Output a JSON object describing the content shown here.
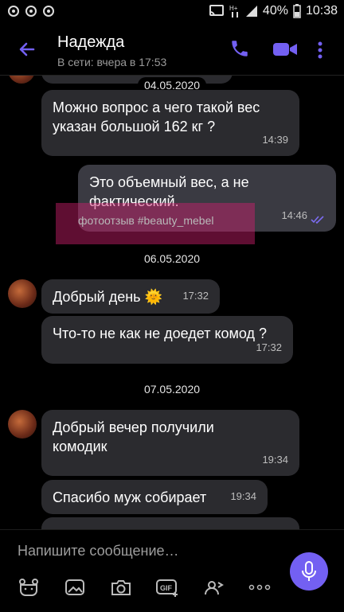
{
  "status_bar": {
    "battery": "40%",
    "time": "10:38"
  },
  "header": {
    "contact_name": "Надежда",
    "last_seen": "В сети: вчера в 17:53"
  },
  "messages": [
    {
      "date": "04.05.2020"
    },
    {
      "text": "Можно вопрос а чего такой вес указан большой 162 кг ?",
      "time": "14:39"
    },
    {
      "text": "Это объемный вес,  а не фактический.",
      "time": "14:46"
    },
    {
      "date": "06.05.2020"
    },
    {
      "text": "Добрый день 🌞",
      "time": "17:32"
    },
    {
      "text": "Что-то не как не доедет комод ?",
      "time": "17:32"
    },
    {
      "date": "07.05.2020"
    },
    {
      "text": "Добрый вечер получили комодик",
      "time": "19:34"
    },
    {
      "text": "Спасибо муж собирает",
      "time": "19:34"
    }
  ],
  "watermark": "фотоотзыв #beauty_mebel",
  "composer": {
    "placeholder": "Напишите сообщение…"
  },
  "colors": {
    "accent": "#7360f2",
    "bubble_in": "#2b2b2f",
    "bubble_out": "#3a3a42"
  }
}
